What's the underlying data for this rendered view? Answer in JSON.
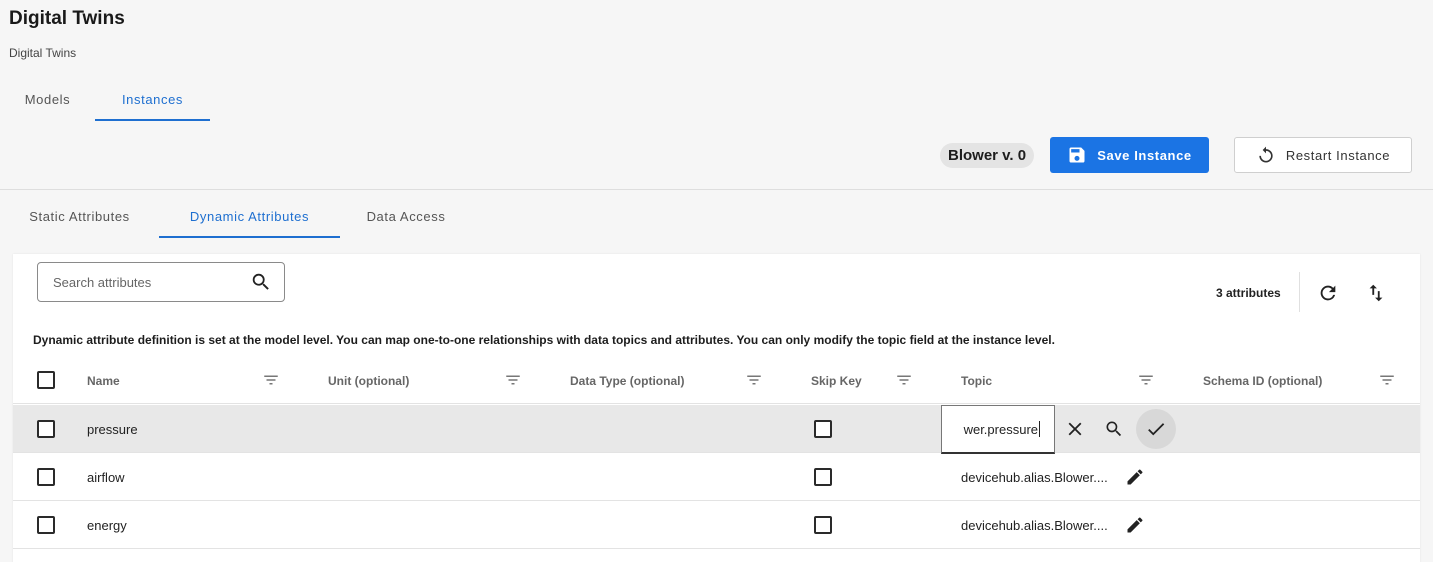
{
  "page": {
    "title": "Digital Twins",
    "breadcrumb": "Digital Twins"
  },
  "top_tabs": [
    {
      "label": "Models",
      "active": false
    },
    {
      "label": "Instances",
      "active": true
    }
  ],
  "header": {
    "version_chip": "Blower v. 0",
    "save_label": "Save Instance",
    "restart_label": "Restart Instance",
    "save_icon": "floppy-disk-icon",
    "restart_icon": "restart-icon"
  },
  "sub_tabs": [
    {
      "label": "Static Attributes",
      "active": false
    },
    {
      "label": "Dynamic Attributes",
      "active": true
    },
    {
      "label": "Data Access",
      "active": false
    }
  ],
  "toolbar": {
    "search_placeholder": "Search attributes",
    "count_label": "3 attributes"
  },
  "info_text": "Dynamic attribute definition is set at the model level. You can map one-to-one relationships with data topics and attributes. You can only modify the topic field at the instance level.",
  "table": {
    "columns": [
      "Name",
      "Unit (optional)",
      "Data Type (optional)",
      "Skip Key",
      "Topic",
      "Schema ID (optional)"
    ],
    "rows": [
      {
        "name": "pressure",
        "unit": "",
        "data_type": "",
        "skip_key": false,
        "topic": "wer.pressure",
        "schema_id": "",
        "editing": true
      },
      {
        "name": "airflow",
        "unit": "",
        "data_type": "",
        "skip_key": false,
        "topic": "devicehub.alias.Blower....",
        "schema_id": "",
        "editing": false
      },
      {
        "name": "energy",
        "unit": "",
        "data_type": "",
        "skip_key": false,
        "topic": "devicehub.alias.Blower....",
        "schema_id": "",
        "editing": false
      }
    ]
  },
  "colors": {
    "accent": "#1b74e4",
    "tab_active": "#1e6fd0",
    "editing_row": "#e8e8e8"
  }
}
